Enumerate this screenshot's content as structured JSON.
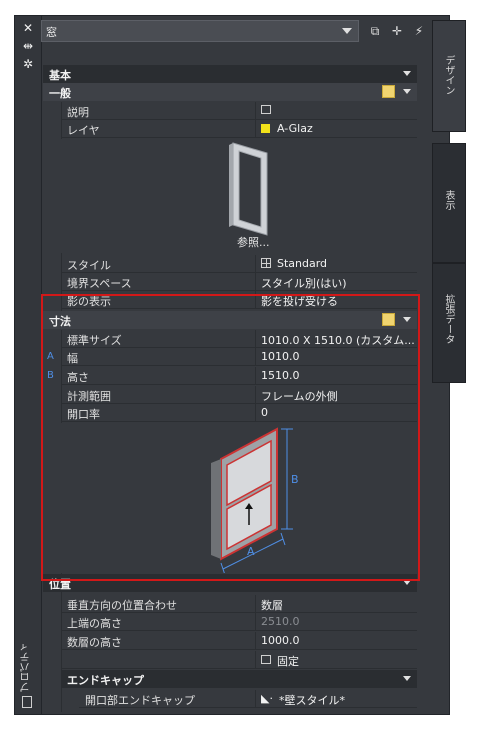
{
  "titlebar": {
    "title": "プロパティ",
    "buttons": [
      "close-icon",
      "autohide-icon",
      "settings-icon"
    ]
  },
  "selector": {
    "value": "窓"
  },
  "tabs": [
    {
      "label": "デザイン",
      "active": true
    },
    {
      "label": "表示",
      "active": false
    },
    {
      "label": "拡張データ",
      "active": false
    }
  ],
  "sections": {
    "basic": "基本",
    "general": "一般",
    "dimensions": "寸法",
    "location": "位置",
    "endcap": "エンドキャップ"
  },
  "general_rows": [
    {
      "key": "説明",
      "value": ""
    },
    {
      "key": "レイヤ",
      "value": "A-Glaz"
    }
  ],
  "preview": {
    "label": "参照..."
  },
  "style_rows": [
    {
      "key": "スタイル",
      "value": "Standard"
    },
    {
      "key": "境界スペース",
      "value": "スタイル別(はい)"
    },
    {
      "key": "影の表示",
      "value": "影を投げ受ける"
    }
  ],
  "dimension_rows": [
    {
      "marker": "",
      "key": "標準サイズ",
      "value": "1010.0 X 1510.0 (カスタム..."
    },
    {
      "marker": "A",
      "key": "幅",
      "value": "1010.0"
    },
    {
      "marker": "B",
      "key": "高さ",
      "value": "1510.0"
    },
    {
      "marker": "",
      "key": "計測範囲",
      "value": "フレームの外側"
    },
    {
      "marker": "",
      "key": "開口率",
      "value": "0"
    }
  ],
  "diagram": {
    "label_a": "A",
    "label_b": "B"
  },
  "location_rows": [
    {
      "key": "垂直方向の位置合わせ",
      "value": "数層"
    },
    {
      "key": "上端の高さ",
      "value": "2510.0",
      "dim": true
    },
    {
      "key": "数層の高さ",
      "value": "1000.0"
    },
    {
      "key": "",
      "value": "固定"
    }
  ],
  "endcap_rows": [
    {
      "key": "開口部エンドキャップ",
      "value": "*壁スタイル*"
    }
  ],
  "colors": {
    "panel": "#36393e",
    "header": "#2a2d31",
    "highlight": "#d21818",
    "layer_swatch": "#f2e21a",
    "accent": "#4f8fe6"
  }
}
